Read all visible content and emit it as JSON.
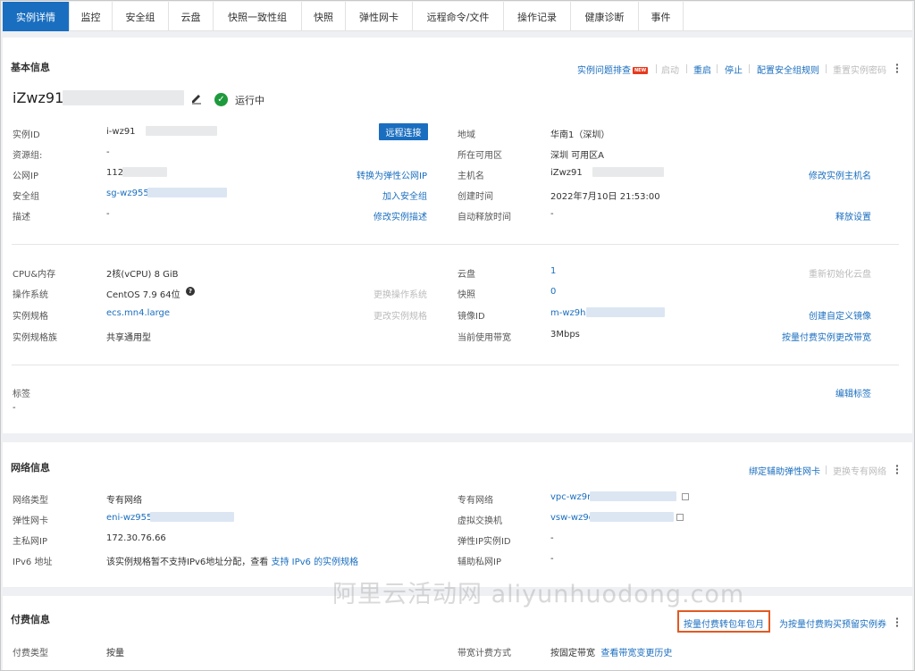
{
  "tabs": [
    "实例详情",
    "监控",
    "安全组",
    "云盘",
    "快照一致性组",
    "快照",
    "弹性网卡",
    "远程命令/文件",
    "操作记录",
    "健康诊断",
    "事件"
  ],
  "basic": {
    "title": "基本信息",
    "actions": {
      "troubleshoot": "实例问题排查",
      "new_badge": "NEW",
      "start": "启动",
      "restart": "重启",
      "stop": "停止",
      "config_sg": "配置安全组规则",
      "reset_pwd": "重置实例密码"
    },
    "instance_name": "iZwz91",
    "status": "运行中",
    "remote_connect": "远程连接",
    "rows_left": [
      {
        "label": "实例ID",
        "value": "i-wz91",
        "action": ""
      },
      {
        "label": "资源组:",
        "value": "-",
        "action": ""
      },
      {
        "label": "公网IP",
        "value": "112",
        "action": "转换为弹性公网IP"
      },
      {
        "label": "安全组",
        "value": "sg-wz955",
        "action": "加入安全组"
      },
      {
        "label": "描述",
        "value": "-",
        "action": "修改实例描述"
      }
    ],
    "rows_right": [
      {
        "label": "地域",
        "value": "华南1（深圳）",
        "action": ""
      },
      {
        "label": "所在可用区",
        "value": "深圳 可用区A",
        "action": ""
      },
      {
        "label": "主机名",
        "value": "iZwz91",
        "action": "修改实例主机名"
      },
      {
        "label": "创建时间",
        "value": "2022年7月10日 21:53:00",
        "action": ""
      },
      {
        "label": "自动释放时间",
        "value": "-",
        "action": "释放设置"
      }
    ],
    "spec_left": [
      {
        "label": "CPU&内存",
        "value": "2核(vCPU) 8 GiB",
        "action": ""
      },
      {
        "label": "操作系统",
        "value": "CentOS 7.9 64位",
        "action": "更换操作系统"
      },
      {
        "label": "实例规格",
        "value": "ecs.mn4.large",
        "action": "更改实例规格"
      },
      {
        "label": "实例规格族",
        "value": "共享通用型",
        "action": ""
      }
    ],
    "spec_right": [
      {
        "label": "云盘",
        "value": "1",
        "action": "重新初始化云盘"
      },
      {
        "label": "快照",
        "value": "0",
        "action": ""
      },
      {
        "label": "镜像ID",
        "value": "m-wz9h",
        "action": "创建自定义镜像"
      },
      {
        "label": "当前使用带宽",
        "value": "3Mbps",
        "action": "按量付费实例更改带宽"
      }
    ],
    "tags_label": "标签",
    "tags_value": "-",
    "tags_action": "编辑标签"
  },
  "network": {
    "title": "网络信息",
    "actions": {
      "bind_eni": "绑定辅助弹性网卡",
      "change_vpc": "更换专有网络"
    },
    "rows_left": [
      {
        "label": "网络类型",
        "value": "专有网络"
      },
      {
        "label": "弹性网卡",
        "value": "eni-wz955"
      },
      {
        "label": "主私网IP",
        "value": "172.30.76.66"
      },
      {
        "label": "IPv6 地址",
        "value": "该实例规格暂不支持IPv6地址分配，查看",
        "link": "支持 IPv6 的实例规格"
      }
    ],
    "rows_right": [
      {
        "label": "专有网络",
        "value": "vpc-wz9r"
      },
      {
        "label": "虚拟交换机",
        "value": "vsw-wz9d"
      },
      {
        "label": "弹性IP实例ID",
        "value": "-"
      },
      {
        "label": "辅助私网IP",
        "value": "-"
      }
    ]
  },
  "billing": {
    "title": "付费信息",
    "actions": {
      "to_subscription": "按量付费转包年包月",
      "buy_reserved": "为按量付费购买预留实例券"
    },
    "type_label": "付费类型",
    "type_value": "按量",
    "bw_label": "带宽计费方式",
    "bw_value": "按固定带宽",
    "bw_link": "查看带宽变更历史"
  },
  "watermark": "阿里云活动网 aliyunhuodong.com",
  "colors": {
    "link": "#1a6ebf",
    "primary": "#1a6ebf",
    "success": "#1e9a3c",
    "highlight": "#e25a22",
    "badge": "#e8381c"
  }
}
